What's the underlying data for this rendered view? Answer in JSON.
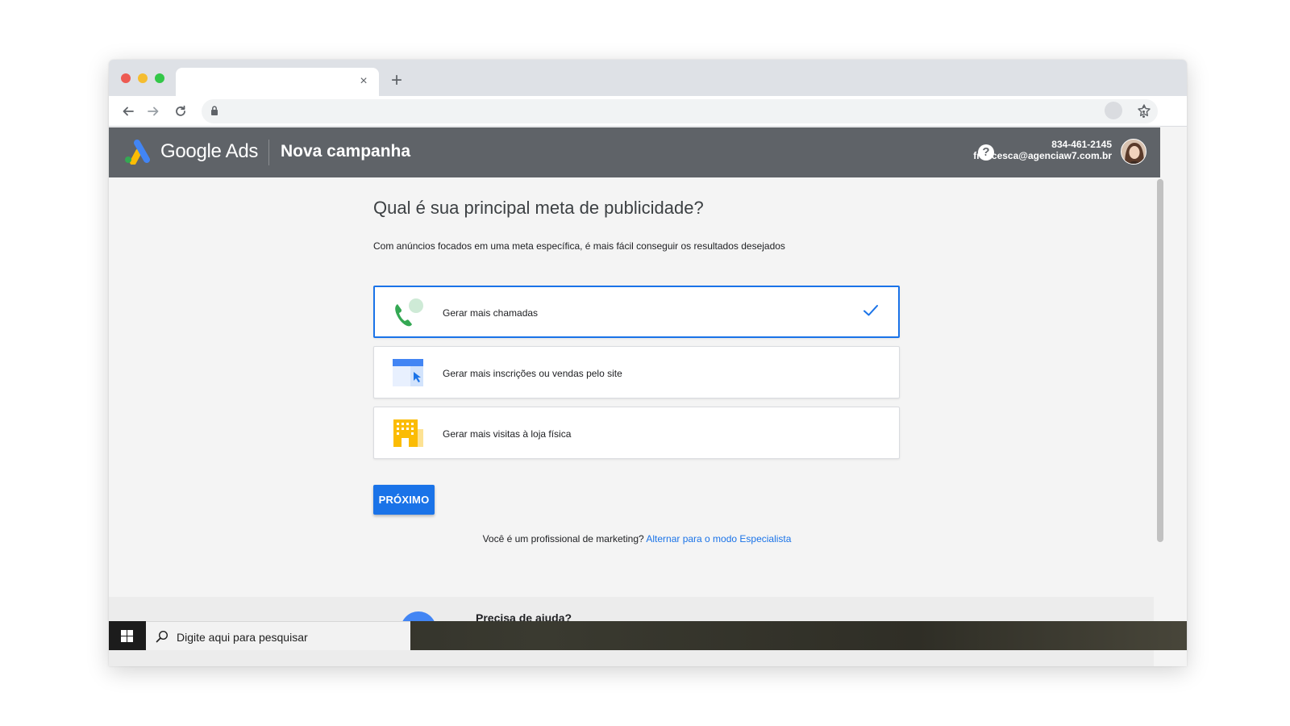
{
  "browser": {
    "tab_close": "×",
    "new_tab": "+"
  },
  "header": {
    "brand": "Google Ads",
    "title": "Nova campanha",
    "help": "?",
    "phone": "834-461-2145",
    "email": "francesca@agenciaw7.com.br"
  },
  "main": {
    "question": "Qual é sua principal meta de publicidade?",
    "subtitle": "Com anúncios focados em uma meta específica, é mais fácil conseguir os resultados desejados",
    "goals": [
      {
        "label": "Gerar mais chamadas",
        "selected": true,
        "icon": "phone-call-icon"
      },
      {
        "label": "Gerar mais inscrições ou vendas pelo site",
        "selected": false,
        "icon": "website-icon"
      },
      {
        "label": "Gerar mais visitas à loja física",
        "selected": false,
        "icon": "store-icon"
      }
    ],
    "next_label": "PRÓXIMO",
    "expert_prompt": "Você é um profissional de marketing?",
    "expert_link": "Alternar para o modo Especialista",
    "help_title": "Precisa de ajuda?"
  },
  "taskbar": {
    "search_placeholder": "Digite aqui para pesquisar"
  },
  "colors": {
    "accent": "#1a73e8",
    "header_bg": "#5f6368",
    "call_icon": "#34a853",
    "store_icon": "#fbbc04"
  }
}
